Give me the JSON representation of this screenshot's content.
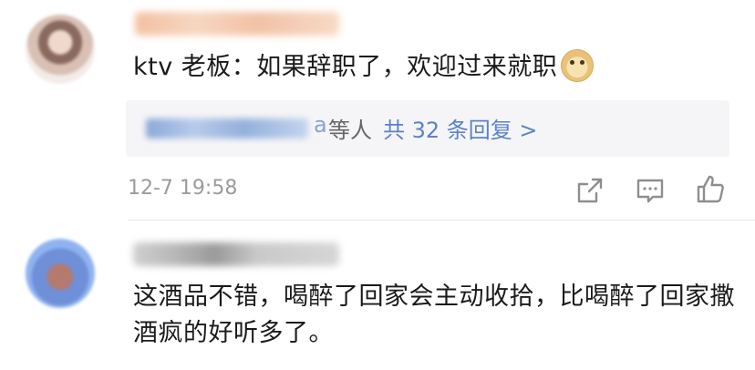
{
  "comments": [
    {
      "avatar_icon": "user-avatar-blurred",
      "username_blurred": true,
      "text": "ktv 老板：如果辞职了，欢迎过来就职",
      "emoji": "doge-emoji-icon",
      "replies": {
        "name_suffix": "a",
        "persons_label": "等人",
        "count_label": "共 32 条回复 >"
      },
      "timestamp": "12-7 19:58",
      "actions": [
        "share-icon",
        "comment-icon",
        "like-icon"
      ]
    },
    {
      "avatar_icon": "user-avatar-blurred",
      "username_blurred": true,
      "text": "这酒品不错，喝醉了回家会主动收拾，比喝醉了回家撒酒疯的好听多了。"
    }
  ],
  "colors": {
    "link": "#5c82c9",
    "timestamp": "#9b9b9b",
    "reply_bg": "#f5f5f7",
    "text": "#1a1a1a"
  }
}
